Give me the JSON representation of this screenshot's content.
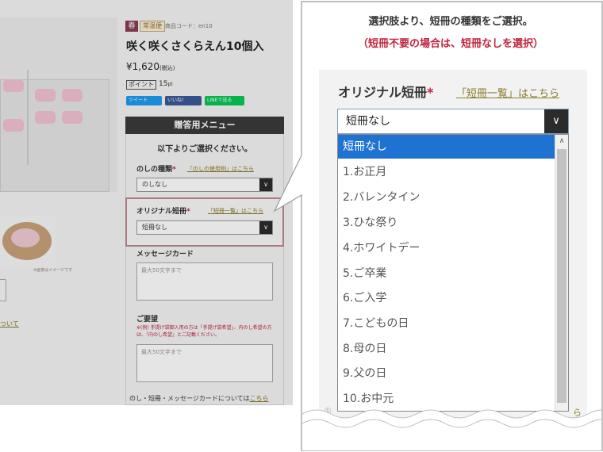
{
  "product": {
    "season_badge": "春",
    "shipping_badge": "常温便",
    "product_code": "商品コード：en10",
    "title": "咲く咲くさくらえん10個入",
    "price": "¥1,620",
    "price_tax": "(税込)",
    "point_label": "ポイント",
    "point_value": "15",
    "point_unit": "pt",
    "thumb_caption": "※画像はイメージです",
    "left_edge_link": "ついて"
  },
  "social": {
    "tweet": "ツイート",
    "like": "いいね！",
    "line": "LINEで送る"
  },
  "gift_menu": {
    "header": "贈答用メニュー",
    "intro": "以下よりご選択ください。",
    "noshi_label": "のしの種類",
    "noshi_link": "「のしの使用例」はこちら",
    "noshi_value": "のしなし",
    "tanzaku_label": "オリジナル短冊",
    "tanzaku_link": "「短冊一覧」はこちら",
    "tanzaku_value": "短冊なし",
    "message_label": "メッセージカード",
    "message_placeholder": "最大50文字まで",
    "request_label": "ご要望",
    "request_note": "※(例) 手提げ袋御入用の方は「手提げ袋希望」、内のし希望の方は、「内のし希望」とご記載ください。",
    "request_placeholder": "最大50文字まで",
    "bottom_note": "のし・短冊・メッセージカードについては",
    "bottom_link": "こちら"
  },
  "callout": {
    "instruction_line1": "選択肢より、短冊の種類をご選択。",
    "instruction_line2": "（短冊不要の場合は、短冊なしを選択）",
    "label": "オリジナル短冊",
    "required_mark": "*",
    "link": "「短冊一覧」はこちら",
    "selected_value": "短冊なし",
    "options": [
      "短冊なし",
      "1.お正月",
      "2.バレンタイン",
      "3.ひな祭り",
      "4.ホワイトデー",
      "5.ご卒業",
      "6.ご入学",
      "7.こどもの日",
      "8.母の日",
      "9.父の日",
      "10.お中元"
    ],
    "under_left": "①",
    "under_right": "ら"
  },
  "icons": {
    "chevron": "chevron-down-icon",
    "scroll_up": "scroll-up-arrow-icon"
  },
  "colors": {
    "accent_red": "#c0233d",
    "highlight_border": "#8b2630",
    "selected_option": "#1e73d2",
    "link_olive": "#8a7a2a"
  }
}
